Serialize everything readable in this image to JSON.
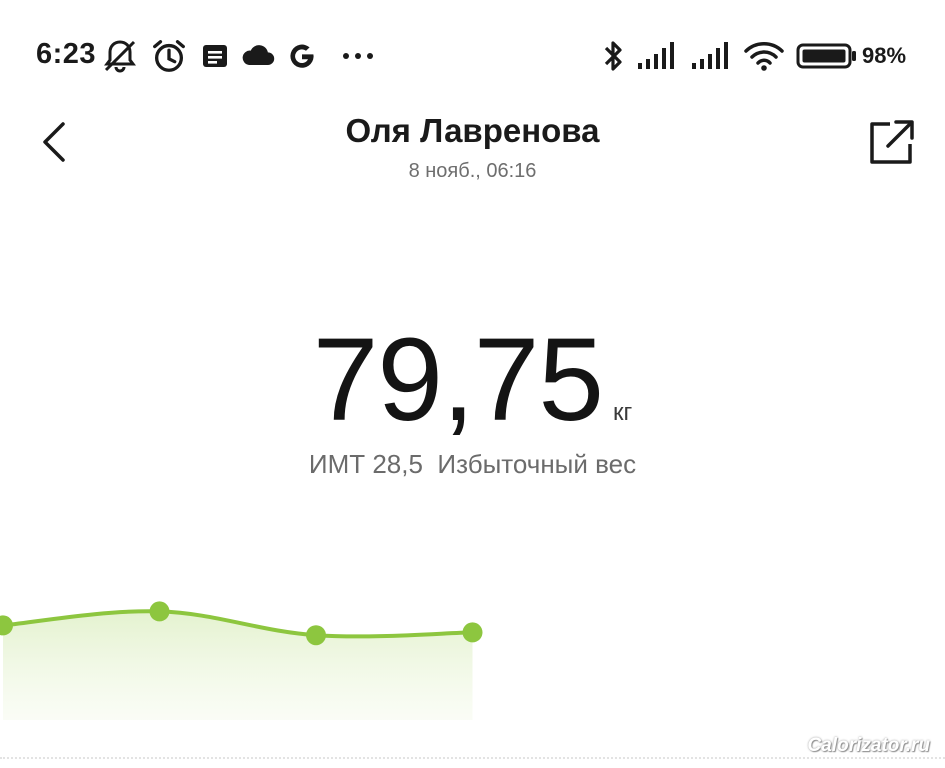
{
  "status_bar": {
    "time": "6:23",
    "battery_percent": "98%",
    "left_icons": [
      "bell-off-icon",
      "alarm-clock-icon",
      "message-icon",
      "cloud-icon",
      "google-icon",
      "more-dots-icon"
    ],
    "right_icons": [
      "bluetooth-icon",
      "signal-icon",
      "signal-icon",
      "wifi-icon",
      "battery-icon"
    ]
  },
  "header": {
    "title": "Оля Лавренова",
    "subtitle": "8 нояб., 06:16"
  },
  "measurement": {
    "weight": "79,75",
    "unit": "кг",
    "bmi_text": "ИМТ 28,5  Избыточный вес"
  },
  "chart_data": {
    "type": "area",
    "values": [
      0.45,
      0.95,
      0.1,
      0.2
    ],
    "points_visible": 4,
    "line_color": "#8dc63f",
    "point_color": "#8dc63f",
    "fill_color": "#eef7e0"
  },
  "watermark": "Calorizator.ru",
  "colors": {
    "accent": "#8dc63f",
    "text_primary": "#1a1a1a",
    "text_secondary": "#6b6b6b"
  }
}
